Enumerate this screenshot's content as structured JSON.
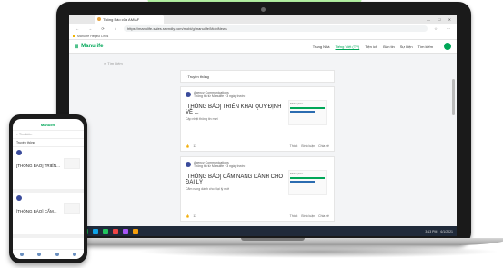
{
  "browser": {
    "tab_title": "Thông Báo của AM/AF",
    "window_controls": [
      "—",
      "☐",
      "✕"
    ],
    "url": "https://manulife-sales.ssvndly.com/mobi/g/manulife/MobiNews",
    "bookmark": "Manulife Helpful Links"
  },
  "app": {
    "brand": "Manulife",
    "nav": [
      {
        "label": "Trang Nhà",
        "icon": "home-icon"
      },
      {
        "label": "Tiếng Việt (TV)",
        "icon": "news-icon",
        "active": true
      },
      {
        "label": "Tiện ích",
        "icon": "tools-icon"
      },
      {
        "label": "Bản tin",
        "icon": "bulletin-icon"
      },
      {
        "label": "Sự kiện",
        "icon": "event-icon"
      },
      {
        "label": "Tìm kiếm",
        "icon": "search-icon"
      }
    ],
    "search_placeholder": "Tìm kiếm",
    "breadcrumb": "Truyền thông",
    "posts": [
      {
        "author": "Agency Communications",
        "meta": "Thông tin từ Manulife · 3 ngày trước",
        "title": "[THÔNG BÁO] TRIỂN KHAI QUY ĐỊNH VỀ ...",
        "desc": "Cập nhật thông tin mới",
        "thumb_label": "Thông báo",
        "likes": "13",
        "actions": [
          "Thích",
          "Bình luận",
          "Chia sẻ"
        ]
      },
      {
        "author": "Agency Communications",
        "meta": "Thông tin từ Manulife · 3 ngày trước",
        "title": "[THÔNG BÁO] CẨM NANG DÀNH CHO ĐẠI LÝ",
        "desc": "Cẩm nang dành cho Đại lý mới",
        "thumb_label": "Thông báo",
        "likes": "13",
        "actions": [
          "Thích",
          "Bình luận",
          "Chia sẻ"
        ]
      }
    ]
  },
  "taskbar": {
    "time": "3:13 PM",
    "date": "6/1/2021"
  },
  "phone": {
    "header": "Manulife",
    "search": "Tìm kiếm",
    "breadcrumb": "Truyền thông",
    "posts": [
      {
        "title": "[THÔNG BÁO] TRIỂN..."
      },
      {
        "title": "[THÔNG BÁO] CẨM..."
      }
    ]
  }
}
